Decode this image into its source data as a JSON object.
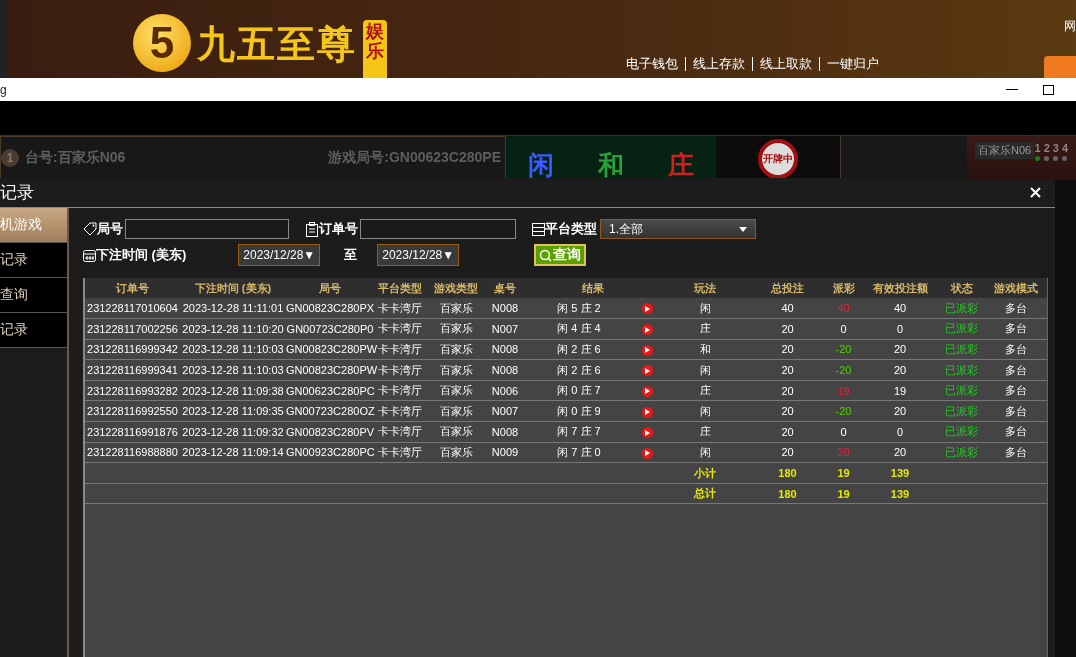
{
  "banner": {
    "logo_mark": "5",
    "logo_text": "九五至尊",
    "badge": "娱乐",
    "links": [
      "电子钱包",
      "线上存款",
      "线上取款",
      "一键归户"
    ],
    "corner_text": "网"
  },
  "browser": {
    "title": "g"
  },
  "game": {
    "table_badge": "1",
    "table": "台号:百家乐N06",
    "round": "游戏局号:GN00623C280PE",
    "bets": [
      "闲",
      "和",
      "庄"
    ],
    "status": "开牌中",
    "video_label": "百家乐N06",
    "views": [
      {
        "label": "1",
        "selected": true
      },
      {
        "label": "2",
        "selected": false
      },
      {
        "label": "3",
        "selected": false
      },
      {
        "label": "4",
        "selected": false
      }
    ]
  },
  "modal": {
    "title": "记录",
    "nav": [
      {
        "label": "机游戏",
        "selected": true
      },
      {
        "label": "记录",
        "selected": false
      },
      {
        "label": "查询",
        "selected": false
      },
      {
        "label": "记录",
        "selected": false
      }
    ],
    "filters": {
      "round_label": "局号",
      "order_label": "订单号",
      "platform_label": "平台类型",
      "platform_value": "1.全部",
      "time_label": "下注时间 (美东)",
      "date_from": "2023/12/28▼",
      "to_label": "至",
      "date_to": "2023/12/28▼",
      "search_button": "查询"
    },
    "table": {
      "columns": [
        "订单号",
        "下注时间 (美东)",
        "局号",
        "平台类型",
        "游戏类型",
        "桌号",
        "结果",
        "玩法",
        "总投注",
        "派彩",
        "有效投注额",
        "状态",
        "游戏模式"
      ],
      "rows": [
        {
          "order": "231228117010604",
          "time": "2023-12-28 11:11:01",
          "round": "GN00823C280PX",
          "platform": "卡卡湾厅",
          "game": "百家乐",
          "table": "N008",
          "result": "闲 5 庄 2",
          "play": "闲",
          "stake": "40",
          "payout": "40",
          "color": "#e0203a",
          "valid": "40",
          "status": "已派彩",
          "mode": "多台"
        },
        {
          "order": "231228117002256",
          "time": "2023-12-28 11:10:20",
          "round": "GN00723C280P0",
          "platform": "卡卡湾厅",
          "game": "百家乐",
          "table": "N007",
          "result": "闲 4 庄 4",
          "play": "庄",
          "stake": "20",
          "payout": "0",
          "color": "#ffffff",
          "valid": "0",
          "status": "已派彩",
          "mode": "多台"
        },
        {
          "order": "231228116999342",
          "time": "2023-12-28 11:10:03",
          "round": "GN00823C280PW",
          "platform": "卡卡湾厅",
          "game": "百家乐",
          "table": "N008",
          "result": "闲 2 庄 6",
          "play": "和",
          "stake": "20",
          "payout": "-20",
          "color": "#55cc00",
          "valid": "20",
          "status": "已派彩",
          "mode": "多台"
        },
        {
          "order": "231228116999341",
          "time": "2023-12-28 11:10:03",
          "round": "GN00823C280PW",
          "platform": "卡卡湾厅",
          "game": "百家乐",
          "table": "N008",
          "result": "闲 2 庄 6",
          "play": "闲",
          "stake": "20",
          "payout": "-20",
          "color": "#55cc00",
          "valid": "20",
          "status": "已派彩",
          "mode": "多台"
        },
        {
          "order": "231228116993282",
          "time": "2023-12-28 11:09:38",
          "round": "GN00623C280PC",
          "platform": "卡卡湾厅",
          "game": "百家乐",
          "table": "N006",
          "result": "闲 0 庄 7",
          "play": "庄",
          "stake": "20",
          "payout": "19",
          "color": "#e0203a",
          "valid": "19",
          "status": "已派彩",
          "mode": "多台"
        },
        {
          "order": "231228116992550",
          "time": "2023-12-28 11:09:35",
          "round": "GN00723C280OZ",
          "platform": "卡卡湾厅",
          "game": "百家乐",
          "table": "N007",
          "result": "闲 0 庄 9",
          "play": "闲",
          "stake": "20",
          "payout": "-20",
          "color": "#55cc00",
          "valid": "20",
          "status": "已派彩",
          "mode": "多台"
        },
        {
          "order": "231228116991876",
          "time": "2023-12-28 11:09:32",
          "round": "GN00823C280PV",
          "platform": "卡卡湾厅",
          "game": "百家乐",
          "table": "N008",
          "result": "闲 7 庄 7",
          "play": "庄",
          "stake": "20",
          "payout": "0",
          "color": "#ffffff",
          "valid": "0",
          "status": "已派彩",
          "mode": "多台"
        },
        {
          "order": "231228116988880",
          "time": "2023-12-28 11:09:14",
          "round": "GN00923C280PC",
          "platform": "卡卡湾厅",
          "game": "百家乐",
          "table": "N009",
          "result": "闲 7 庄 0",
          "play": "闲",
          "stake": "20",
          "payout": "20",
          "color": "#e0203a",
          "valid": "20",
          "status": "已派彩",
          "mode": "多台"
        }
      ],
      "totals": [
        {
          "label": "小计",
          "stake": "180",
          "payout": "19",
          "valid": "139"
        },
        {
          "label": "总计",
          "stake": "180",
          "payout": "19",
          "valid": "139"
        }
      ]
    }
  }
}
